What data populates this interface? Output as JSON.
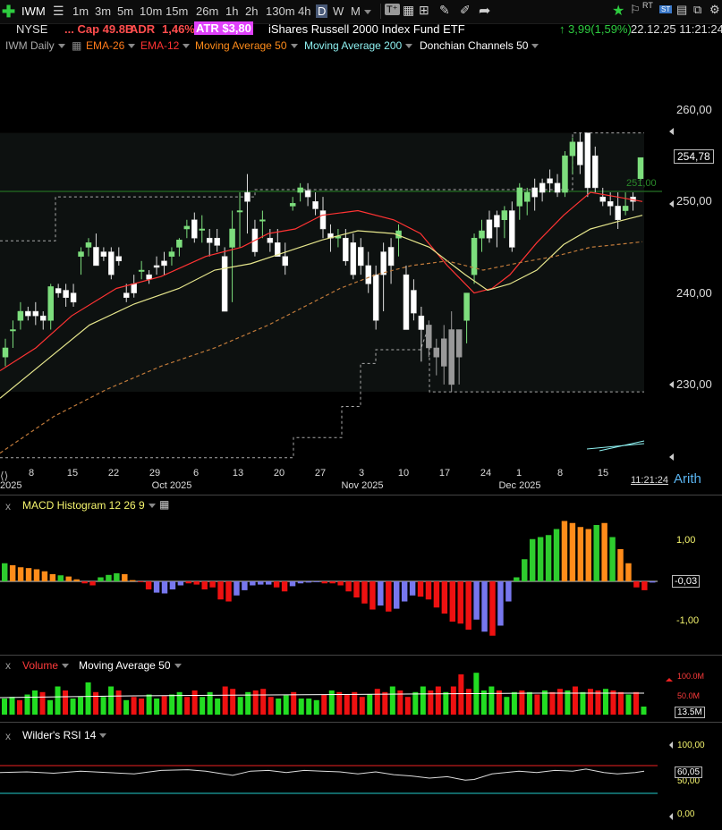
{
  "toolbar": {
    "symbol": "IWM",
    "timeframes": [
      "1m",
      "3m",
      "5m",
      "10m",
      "15m",
      "26m",
      "1h",
      "2h",
      "130m",
      "4h",
      "D",
      "W",
      "M"
    ],
    "active_timeframe": "D"
  },
  "info": {
    "exchange": "NYSE",
    "mktcap": "... Cap 49.8B",
    "adr_label": "ADR",
    "adr_value": "1,46%",
    "atr": "ATR $3,80",
    "name": "iShares Russell 2000 Index Fund ETF",
    "change": "3,99(1,59%)",
    "datetime": "22.12.25 11:21:24"
  },
  "legend": {
    "chart_name": "IWM Daily",
    "ema26": "EMA-26",
    "ema12": "EMA-12",
    "ma50": "Moving Average 50",
    "ma200": "Moving Average 200",
    "donchian": "Donchian Channels 50"
  },
  "price_axis": {
    "ticks": [
      {
        "v": 260,
        "label": "260,00"
      },
      {
        "v": 250,
        "label": "250,00"
      },
      {
        "v": 240,
        "label": "240,00"
      },
      {
        "v": 230,
        "label": "230,00"
      }
    ],
    "last_price": "254,78",
    "ma_label": "251,00"
  },
  "x_axis": {
    "days": [
      "8",
      "15",
      "22",
      "29",
      "6",
      "13",
      "20",
      "27",
      "3",
      "10",
      "17",
      "24",
      "1",
      "8",
      "15"
    ],
    "months": [
      "Oct 2025",
      "Nov 2025",
      "Dec 2025"
    ],
    "partial_month": "2025",
    "time": "11:21:24",
    "scale": "Arith"
  },
  "macd": {
    "title": "MACD Histogram 12 26 9",
    "ticks": [
      "1,00",
      "-1,00"
    ],
    "current": "-0,03"
  },
  "volume": {
    "title": "Volume",
    "ma": "Moving Average 50",
    "ticks": [
      "100.0M",
      "50.0M"
    ],
    "current": "13.5M"
  },
  "rsi": {
    "title": "Wilder's RSI 14",
    "ticks": [
      "100,00",
      "50,00",
      "0,00"
    ],
    "current": "60,05"
  },
  "colors": {
    "up": "#7dde7d",
    "down": "#ffffff",
    "ema26": "#ff6a1a",
    "ema12": "#ff3333",
    "ma50": "#e6e68c",
    "ma200": "#c07a3a",
    "donchian": "#aaaaaa",
    "macd_green": "#2ecc2e",
    "macd_orange": "#ff8c1a",
    "macd_red": "#ee1111",
    "macd_blue": "#7777ee",
    "vol_green": "#22dd22",
    "vol_red": "#ee1111",
    "rsi_line": "#dddddd",
    "rsi_70": "#ee2222",
    "rsi_30": "#22cccc"
  }
}
